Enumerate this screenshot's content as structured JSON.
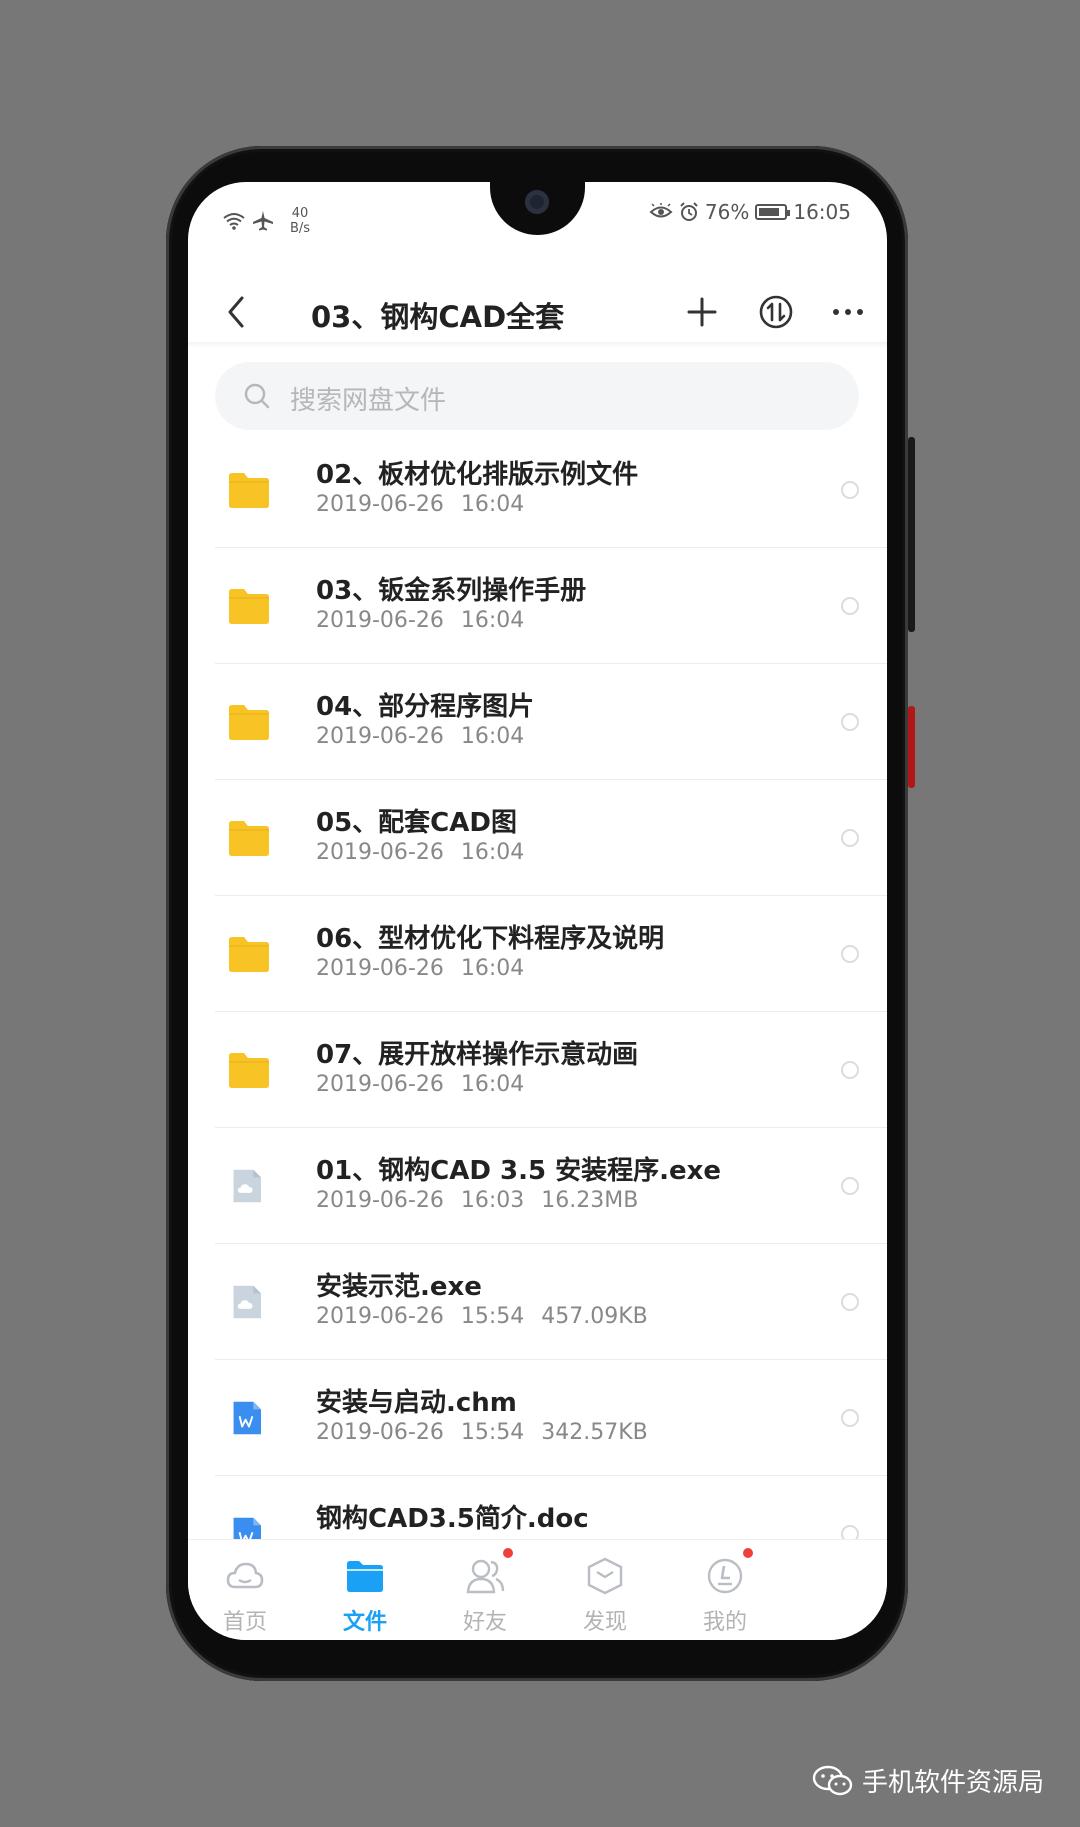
{
  "status": {
    "net_speed_value": "40",
    "net_speed_unit": "B/s",
    "battery": "76%",
    "time": "16:05"
  },
  "header": {
    "title": "03、钢构CAD全套"
  },
  "search": {
    "placeholder": "搜索网盘文件"
  },
  "files": [
    {
      "name": "02、板材优化排版示例文件",
      "date": "2019-06-26",
      "time": "16:04",
      "size": "",
      "type": "folder"
    },
    {
      "name": "03、钣金系列操作手册",
      "date": "2019-06-26",
      "time": "16:04",
      "size": "",
      "type": "folder"
    },
    {
      "name": "04、部分程序图片",
      "date": "2019-06-26",
      "time": "16:04",
      "size": "",
      "type": "folder"
    },
    {
      "name": "05、配套CAD图",
      "date": "2019-06-26",
      "time": "16:04",
      "size": "",
      "type": "folder"
    },
    {
      "name": "06、型材优化下料程序及说明",
      "date": "2019-06-26",
      "time": "16:04",
      "size": "",
      "type": "folder"
    },
    {
      "name": "07、展开放样操作示意动画",
      "date": "2019-06-26",
      "time": "16:04",
      "size": "",
      "type": "folder"
    },
    {
      "name": "01、钢构CAD 3.5 安装程序.exe",
      "date": "2019-06-26",
      "time": "16:03",
      "size": "16.23MB",
      "type": "exe"
    },
    {
      "name": "安装示范.exe",
      "date": "2019-06-26",
      "time": "15:54",
      "size": "457.09KB",
      "type": "exe"
    },
    {
      "name": "安装与启动.chm",
      "date": "2019-06-26",
      "time": "15:54",
      "size": "342.57KB",
      "type": "doc"
    },
    {
      "name": "钢构CAD3.5简介.doc",
      "date": "",
      "time": "",
      "size": "",
      "type": "doc"
    }
  ],
  "tabs": [
    {
      "label": "首页",
      "icon": "cloud-icon",
      "active": false,
      "badge": false
    },
    {
      "label": "文件",
      "icon": "folder-icon",
      "active": true,
      "badge": false
    },
    {
      "label": "好友",
      "icon": "friends-icon",
      "active": false,
      "badge": true
    },
    {
      "label": "发现",
      "icon": "discover-icon",
      "active": false,
      "badge": false
    },
    {
      "label": "我的",
      "icon": "profile-icon",
      "active": false,
      "badge": true
    }
  ],
  "watermark": "手机软件资源局",
  "colors": {
    "accent": "#1aa1f5",
    "folder": "#f7c325",
    "badge": "#f1403c",
    "exe_icon": "#c9d4df",
    "doc_icon": "#3a8ef0"
  }
}
